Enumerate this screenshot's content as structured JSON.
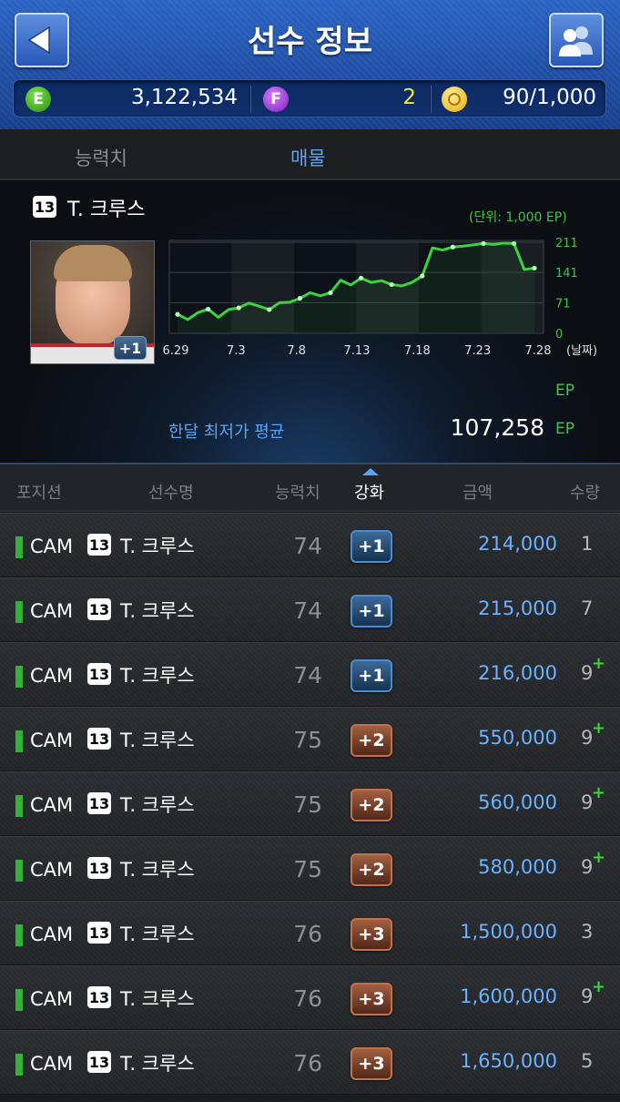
{
  "header": {
    "title": "선수 정보",
    "back_icon": "back-arrow-icon",
    "friends_icon": "friends-icon"
  },
  "currency": {
    "e_icon_letter": "E",
    "e_value": "3,122,534",
    "f_icon_letter": "F",
    "f_value": "2",
    "ball_value": "90/1,000",
    "f_color": "#f2e63c"
  },
  "tabs": [
    {
      "label": "능력치",
      "active": false
    },
    {
      "label": "매물",
      "active": true
    }
  ],
  "player": {
    "season": "13",
    "name": "T. 크루스",
    "photo_enhance": "+1"
  },
  "chart_note": "(단위: 1,000 EP)",
  "ep_unit": "EP",
  "average": {
    "label": "한달 최저가 평균",
    "value": "107,258",
    "unit": "EP"
  },
  "chart_data": {
    "type": "line",
    "x_tick_labels": [
      "6.29",
      "7.3",
      "7.8",
      "7.13",
      "7.18",
      "7.23",
      "7.28"
    ],
    "x_unit": "(날짜)",
    "y_tick_labels": [
      "0",
      "71",
      "141",
      "211"
    ],
    "ylim": [
      0,
      211
    ],
    "values": [
      44,
      32,
      48,
      56,
      37,
      55,
      59,
      70,
      63,
      55,
      71,
      72,
      81,
      94,
      87,
      94,
      123,
      112,
      128,
      118,
      122,
      113,
      110,
      118,
      133,
      198,
      193,
      200,
      202,
      205,
      208,
      206,
      209,
      208,
      148,
      151
    ],
    "line_color": "#3dd23f"
  },
  "list_header": {
    "position": "포지션",
    "name": "선수명",
    "ability": "능력치",
    "enhance": "강화",
    "price": "금액",
    "quantity": "수량"
  },
  "rows": [
    {
      "pos": "CAM",
      "season": "13",
      "name": "T. 크루스",
      "ovr": "74",
      "plus": "+1",
      "tier": "blue",
      "price": "214,000",
      "qty": "1",
      "qty_plus": ""
    },
    {
      "pos": "CAM",
      "season": "13",
      "name": "T. 크루스",
      "ovr": "74",
      "plus": "+1",
      "tier": "blue",
      "price": "215,000",
      "qty": "7",
      "qty_plus": ""
    },
    {
      "pos": "CAM",
      "season": "13",
      "name": "T. 크루스",
      "ovr": "74",
      "plus": "+1",
      "tier": "blue",
      "price": "216,000",
      "qty": "9",
      "qty_plus": "+"
    },
    {
      "pos": "CAM",
      "season": "13",
      "name": "T. 크루스",
      "ovr": "75",
      "plus": "+2",
      "tier": "bronze",
      "price": "550,000",
      "qty": "9",
      "qty_plus": "+"
    },
    {
      "pos": "CAM",
      "season": "13",
      "name": "T. 크루스",
      "ovr": "75",
      "plus": "+2",
      "tier": "bronze",
      "price": "560,000",
      "qty": "9",
      "qty_plus": "+"
    },
    {
      "pos": "CAM",
      "season": "13",
      "name": "T. 크루스",
      "ovr": "75",
      "plus": "+2",
      "tier": "bronze",
      "price": "580,000",
      "qty": "9",
      "qty_plus": "+"
    },
    {
      "pos": "CAM",
      "season": "13",
      "name": "T. 크루스",
      "ovr": "76",
      "plus": "+3",
      "tier": "bronze",
      "price": "1,500,000",
      "qty": "3",
      "qty_plus": ""
    },
    {
      "pos": "CAM",
      "season": "13",
      "name": "T. 크루스",
      "ovr": "76",
      "plus": "+3",
      "tier": "bronze",
      "price": "1,600,000",
      "qty": "9",
      "qty_plus": "+"
    },
    {
      "pos": "CAM",
      "season": "13",
      "name": "T. 크루스",
      "ovr": "76",
      "plus": "+3",
      "tier": "bronze",
      "price": "1,650,000",
      "qty": "5",
      "qty_plus": ""
    }
  ]
}
